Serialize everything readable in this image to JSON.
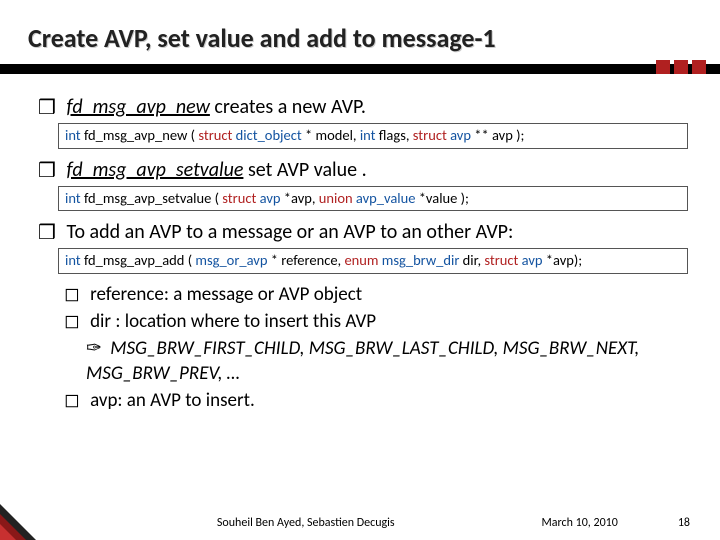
{
  "title": "Create AVP, set value and add to message-1",
  "bullets": {
    "b1a_func": "fd_msg_avp_new",
    "b1a_rest": " creates a new AVP.",
    "code1": {
      "p1": "int",
      "p2": " fd_msg_avp_new ( ",
      "p3": "struct",
      "p4": " ",
      "p5": "dict_object",
      "p6": " * model, ",
      "p7": "int",
      "p8": " flags, ",
      "p9": "struct",
      "p10": " ",
      "p11": "avp",
      "p12": " ** avp );"
    },
    "b1b_func": "fd_msg_avp_setvalue",
    "b1b_rest": "  set AVP value .",
    "code2": {
      "p1": "int",
      "p2": " fd_msg_avp_setvalue ( ",
      "p3": "struct",
      "p4": " ",
      "p5": "avp",
      "p6": " *avp, ",
      "p7": "union",
      "p8": " ",
      "p9": "avp_value",
      "p10": " *value );"
    },
    "b1c": "To add an AVP to a message or an AVP to an other AVP:",
    "code3": {
      "p1": "int",
      "p2": " fd_msg_avp_add ( ",
      "p3": "msg_or_avp",
      "p4": " * reference, ",
      "p5": "enum",
      "p6": " ",
      "p7": "msg_brw_dir",
      "p8": " dir, ",
      "p9": "struct",
      "p10": " ",
      "p11": "avp",
      "p12": " *avp);"
    },
    "b2a": "reference:  a message or AVP object",
    "b2b": "dir : location where to insert this AVP",
    "b3a": "MSG_BRW_FIRST_CHILD, MSG_BRW_LAST_CHILD, MSG_BRW_NEXT, MSG_BRW_PREV, …",
    "b2c": "avp: an AVP to insert."
  },
  "footer": {
    "authors": "Souheil Ben Ayed, Sebastien Decugis",
    "date": "March 10, 2010",
    "page": "18"
  },
  "glyphs": {
    "square_outline": "❒",
    "square_small": "◻",
    "tilde": "✑"
  }
}
